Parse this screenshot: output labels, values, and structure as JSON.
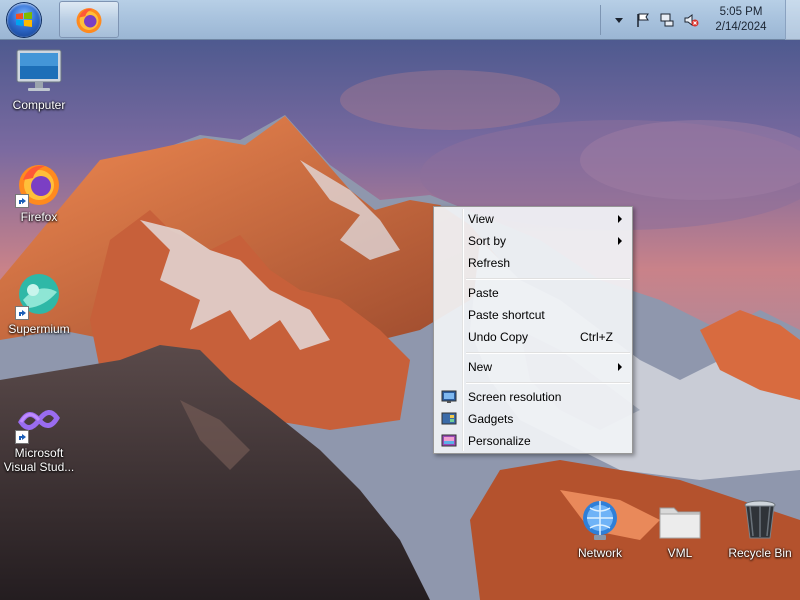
{
  "taskbar": {
    "start_button": "start-button",
    "pinned": [
      {
        "name": "Firefox",
        "icon": "firefox-icon"
      }
    ],
    "tray_icons": [
      "chevron-up-icon",
      "flag-icon",
      "network-icon",
      "volume-muted-icon"
    ],
    "clock": {
      "time": "5:05 PM",
      "date": "2/14/2024"
    }
  },
  "desktop_icons": [
    {
      "label": "Computer",
      "icon": "computer-icon"
    },
    {
      "label": "Firefox",
      "icon": "firefox-icon"
    },
    {
      "label": "Supermium",
      "icon": "supermium-icon"
    },
    {
      "label": "Microsoft Visual Stud...",
      "icon": "visual-studio-icon"
    },
    {
      "label": "Network",
      "icon": "network-globe-icon"
    },
    {
      "label": "VML",
      "icon": "folder-icon"
    },
    {
      "label": "Recycle Bin",
      "icon": "recycle-bin-icon"
    }
  ],
  "context_menu": {
    "items": [
      {
        "label": "View",
        "submenu": true
      },
      {
        "label": "Sort by",
        "submenu": true
      },
      {
        "label": "Refresh"
      },
      {
        "label": "Paste"
      },
      {
        "label": "Paste shortcut"
      },
      {
        "label": "Undo Copy",
        "shortcut": "Ctrl+Z"
      },
      {
        "label": "New",
        "submenu": true
      },
      {
        "label": "Screen resolution",
        "icon": "screen-resolution-icon"
      },
      {
        "label": "Gadgets",
        "icon": "gadgets-icon"
      },
      {
        "label": "Personalize",
        "icon": "personalize-icon"
      }
    ]
  },
  "colors": {
    "taskbar": "#a8c2dd",
    "menu_bg": "#f1f3f6"
  }
}
